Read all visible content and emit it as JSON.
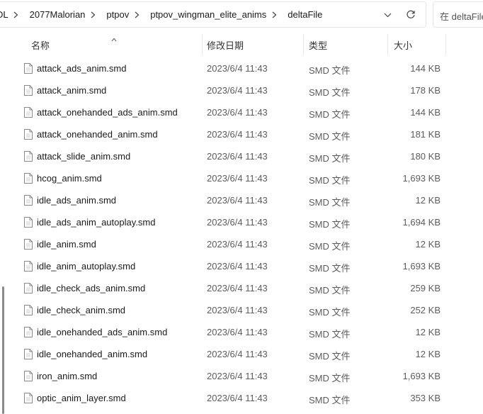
{
  "address_bar": {
    "crumbs": [
      "DL",
      "2077Malorian",
      "ptpov",
      "ptpov_wingman_elite_anims",
      "deltaFile"
    ]
  },
  "search": {
    "placeholder": "在 deltaFile"
  },
  "columns": {
    "name": "名称",
    "date": "修改日期",
    "type": "类型",
    "size": "大小"
  },
  "files": [
    {
      "name": "attack_ads_anim.smd",
      "date": "2023/6/4 11:43",
      "type": "SMD 文件",
      "size": "144 KB"
    },
    {
      "name": "attack_anim.smd",
      "date": "2023/6/4 11:43",
      "type": "SMD 文件",
      "size": "178 KB"
    },
    {
      "name": "attack_onehanded_ads_anim.smd",
      "date": "2023/6/4 11:43",
      "type": "SMD 文件",
      "size": "144 KB"
    },
    {
      "name": "attack_onehanded_anim.smd",
      "date": "2023/6/4 11:43",
      "type": "SMD 文件",
      "size": "181 KB"
    },
    {
      "name": "attack_slide_anim.smd",
      "date": "2023/6/4 11:43",
      "type": "SMD 文件",
      "size": "180 KB"
    },
    {
      "name": "hcog_anim.smd",
      "date": "2023/6/4 11:43",
      "type": "SMD 文件",
      "size": "1,693 KB"
    },
    {
      "name": "idle_ads_anim.smd",
      "date": "2023/6/4 11:43",
      "type": "SMD 文件",
      "size": "12 KB"
    },
    {
      "name": "idle_ads_anim_autoplay.smd",
      "date": "2023/6/4 11:43",
      "type": "SMD 文件",
      "size": "1,694 KB"
    },
    {
      "name": "idle_anim.smd",
      "date": "2023/6/4 11:43",
      "type": "SMD 文件",
      "size": "12 KB"
    },
    {
      "name": "idle_anim_autoplay.smd",
      "date": "2023/6/4 11:43",
      "type": "SMD 文件",
      "size": "1,693 KB"
    },
    {
      "name": "idle_check_ads_anim.smd",
      "date": "2023/6/4 11:43",
      "type": "SMD 文件",
      "size": "259 KB"
    },
    {
      "name": "idle_check_anim.smd",
      "date": "2023/6/4 11:43",
      "type": "SMD 文件",
      "size": "252 KB"
    },
    {
      "name": "idle_onehanded_ads_anim.smd",
      "date": "2023/6/4 11:43",
      "type": "SMD 文件",
      "size": "12 KB"
    },
    {
      "name": "idle_onehanded_anim.smd",
      "date": "2023/6/4 11:43",
      "type": "SMD 文件",
      "size": "12 KB"
    },
    {
      "name": "iron_anim.smd",
      "date": "2023/6/4 11:43",
      "type": "SMD 文件",
      "size": "1,693 KB"
    },
    {
      "name": "optic_anim_layer.smd",
      "date": "2023/6/4 11:43",
      "type": "SMD 文件",
      "size": "353 KB"
    }
  ],
  "icons": {
    "breadcrumb_separator": "chevron-right-icon",
    "address_dropdown": "chevron-down-icon",
    "refresh": "refresh-icon",
    "file": "file-icon",
    "sort": "sort-ascending-icon"
  }
}
